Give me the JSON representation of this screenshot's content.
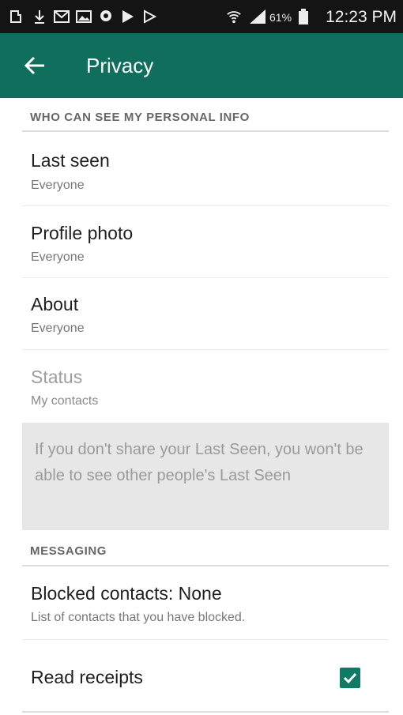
{
  "status_bar": {
    "battery_percent": "61%",
    "time": "12:23 PM",
    "icons": [
      "download-icon",
      "gmail-icon",
      "gallery-icon",
      "location-icon",
      "play-store-icon",
      "play-icon",
      "wifi-icon",
      "signal-icon",
      "battery-icon"
    ]
  },
  "app_bar": {
    "title": "Privacy",
    "back_icon": "arrow-back-icon",
    "color": "#0f6e5c"
  },
  "sections": {
    "personal_info_header": "WHO CAN SEE MY PERSONAL INFO",
    "messaging_header": "MESSAGING"
  },
  "items": {
    "last_seen": {
      "title": "Last seen",
      "value": "Everyone"
    },
    "profile_photo": {
      "title": "Profile photo",
      "value": "Everyone"
    },
    "about": {
      "title": "About",
      "value": "Everyone"
    },
    "status": {
      "title": "Status",
      "value": "My contacts"
    },
    "blocked": {
      "title": "Blocked contacts: None",
      "subtitle": "List of contacts that you have blocked."
    },
    "read_receipts": {
      "title": "Read receipts",
      "checked": true
    }
  },
  "info_note": "If you don't share your Last Seen, you won't be able to see other people's Last Seen",
  "accent_color": "#0f7a66"
}
